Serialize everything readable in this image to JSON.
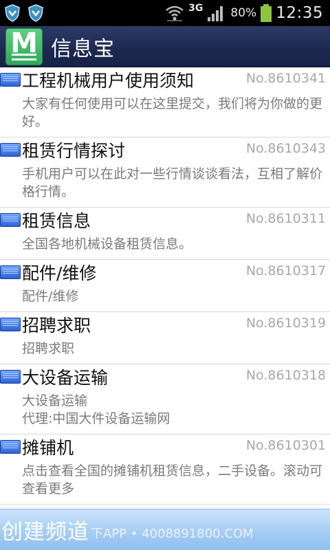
{
  "status_bar": {
    "network": "3G",
    "battery_percent": "80%",
    "time": "12:35",
    "icons": [
      "shield-icon",
      "shield-icon",
      "wifi-icon",
      "signal-icon",
      "battery-icon"
    ]
  },
  "app": {
    "logo_letter": "M",
    "title": "信息宝"
  },
  "list": [
    {
      "title": "工程机械用户使用须知",
      "number": "No.8610341",
      "desc": "大家有任何使用可以在这里提交，我们将为你做的更好。"
    },
    {
      "title": "租赁行情探讨",
      "number": "No.8610343",
      "desc": "手机用户可以在此对一些行情谈谈看法，互相了解价格行情。"
    },
    {
      "title": "租赁信息",
      "number": "No.8610311",
      "desc": "全国各地机械设备租赁信息。"
    },
    {
      "title": "配件/维修",
      "number": "No.8610317",
      "desc": "配件/维修"
    },
    {
      "title": "招聘求职",
      "number": "No.8610319",
      "desc": "招聘求职"
    },
    {
      "title": "大设备运输",
      "number": "No.8610318",
      "desc": "大设备运输\n代理:中国大件设备运输网"
    },
    {
      "title": "摊铺机",
      "number": "No.8610301",
      "desc": "点击查看全国的摊铺机租赁信息，二手设备。滚动可查看更多"
    }
  ],
  "bottom": {
    "create_label": "创建频道",
    "watermark": "下APP • 4008891800.COM"
  },
  "colors": {
    "app_bar": "#1c2850",
    "logo_green": "#3db865",
    "bottom_bar": "#a9cff3",
    "number_gray": "#a8a8a8",
    "desc_gray": "#7a7a7a"
  }
}
